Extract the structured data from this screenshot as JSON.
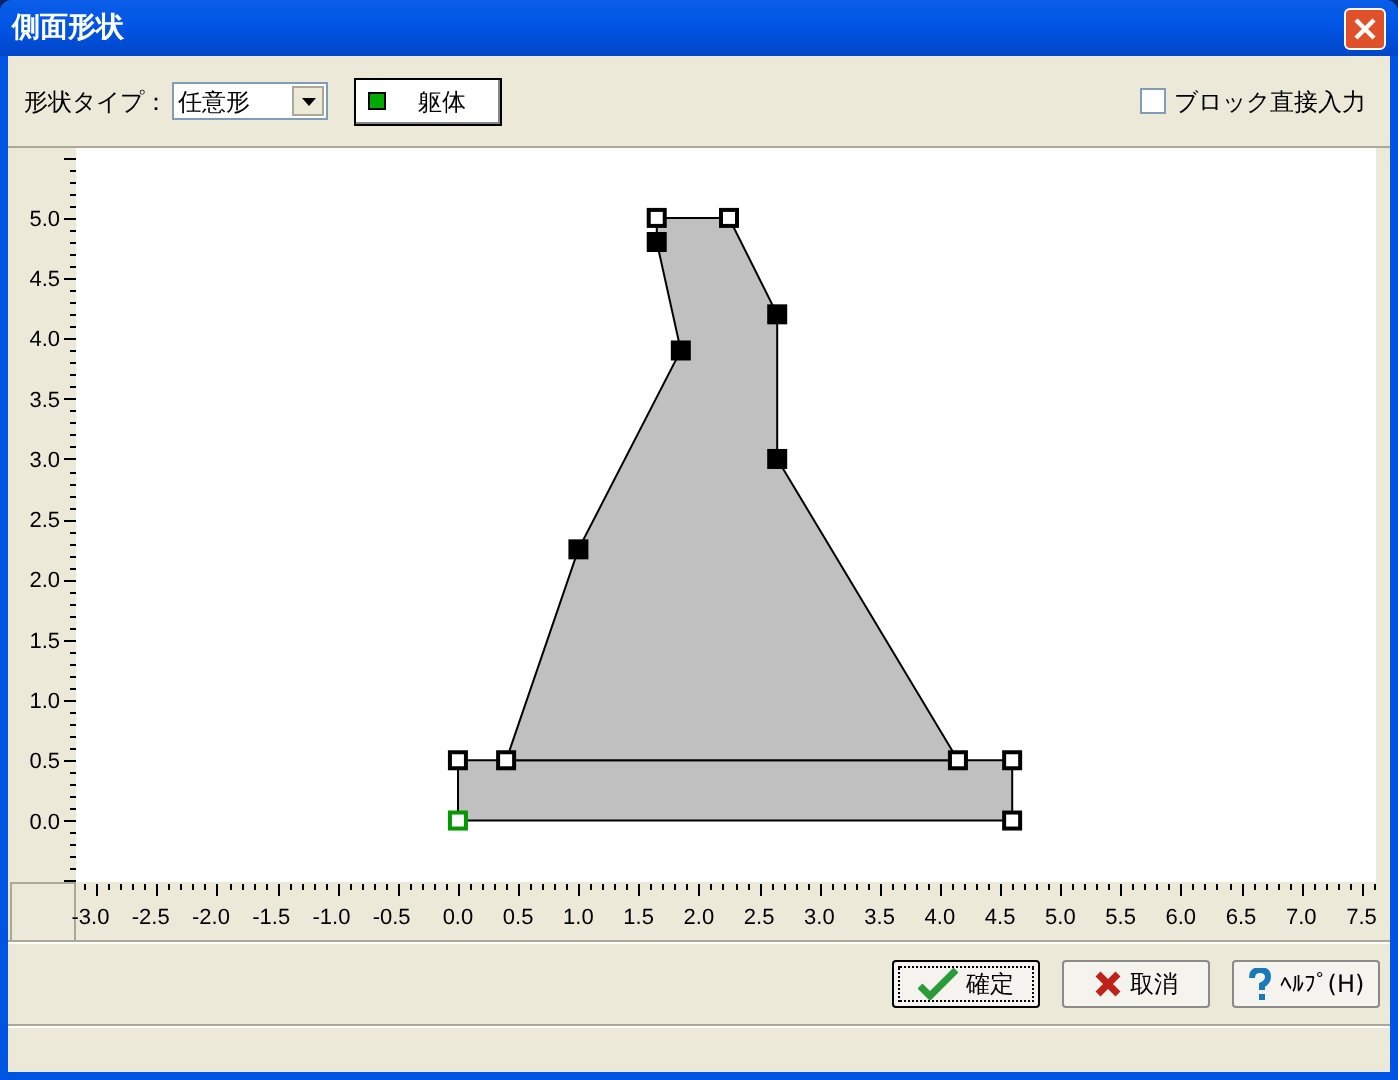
{
  "window": {
    "title": "側面形状"
  },
  "toolbar": {
    "shape_type_label": "形状タイプ：",
    "shape_type": {
      "value": "任意形"
    },
    "legend": {
      "label": "躯体",
      "color": "#00aa00"
    },
    "block_direct_input": {
      "label": "ブロック直接入力",
      "checked": false
    }
  },
  "chart": {
    "chart_data": {
      "type": "area",
      "xlim": [
        -3.17,
        7.62
      ],
      "ylim": [
        -0.51,
        5.58
      ],
      "xticks": [
        {
          "value": -3,
          "label": "-3.0"
        },
        {
          "value": -2.5,
          "label": "-2.5"
        },
        {
          "value": -2,
          "label": "-2.0"
        },
        {
          "value": -1.5,
          "label": "-1.5"
        },
        {
          "value": -1,
          "label": "-1.0"
        },
        {
          "value": -0.5,
          "label": "-0.5"
        },
        {
          "value": 0,
          "label": "0.0"
        },
        {
          "value": 0.5,
          "label": "0.5"
        },
        {
          "value": 1,
          "label": "1.0"
        },
        {
          "value": 1.5,
          "label": "1.5"
        },
        {
          "value": 2,
          "label": "2.0"
        },
        {
          "value": 2.5,
          "label": "2.5"
        },
        {
          "value": 3,
          "label": "3.0"
        },
        {
          "value": 3.5,
          "label": "3.5"
        },
        {
          "value": 4,
          "label": "4.0"
        },
        {
          "value": 4.5,
          "label": "4.5"
        },
        {
          "value": 5,
          "label": "5.0"
        },
        {
          "value": 5.5,
          "label": "5.5"
        },
        {
          "value": 6,
          "label": "6.0"
        },
        {
          "value": 6.5,
          "label": "6.5"
        },
        {
          "value": 7,
          "label": "7.0"
        },
        {
          "value": 7.5,
          "label": "7.5"
        }
      ],
      "yticks": [
        {
          "value": 0,
          "label": "0.0"
        },
        {
          "value": 0.5,
          "label": "0.5"
        },
        {
          "value": 1,
          "label": "1.0"
        },
        {
          "value": 1.5,
          "label": "1.5"
        },
        {
          "value": 2,
          "label": "2.0"
        },
        {
          "value": 2.5,
          "label": "2.5"
        },
        {
          "value": 3,
          "label": "3.0"
        },
        {
          "value": 3.5,
          "label": "3.5"
        },
        {
          "value": 4,
          "label": "4.0"
        },
        {
          "value": 4.5,
          "label": "4.5"
        },
        {
          "value": 5,
          "label": "5.0"
        }
      ],
      "series": [
        {
          "color": "#000000",
          "x": [
            0,
            4.6,
            4.6,
            0,
            0
          ],
          "values": [
            0,
            0,
            0.5,
            0.5,
            0
          ]
        },
        {
          "color": "#000000",
          "x": [
            0.4,
            4.15,
            2.65,
            2.65,
            2.25,
            1.65,
            1.65,
            1.85,
            1.0,
            0.4
          ],
          "values": [
            0.5,
            0.5,
            3.0,
            4.2,
            5.0,
            5.0,
            4.8,
            3.9,
            2.25,
            0.5
          ]
        },
        {
          "type": "scatter",
          "marker": "square-open",
          "color": "#009900",
          "x": [
            0
          ],
          "values": [
            0
          ]
        },
        {
          "type": "scatter",
          "marker": "square-open",
          "color": "#000000",
          "x": [
            0,
            0.4,
            4.15,
            4.6,
            4.6,
            1.65,
            2.25
          ],
          "values": [
            0.5,
            0.5,
            0.5,
            0.5,
            0,
            5.0,
            5.0
          ]
        },
        {
          "type": "scatter",
          "marker": "square",
          "color": "#000000",
          "x": [
            1.65,
            1.85,
            2.65,
            2.65,
            1.0
          ],
          "values": [
            4.8,
            3.9,
            4.2,
            3.0,
            2.25
          ]
        }
      ]
    }
  },
  "buttons": [
    {
      "label": "確定",
      "kind": "ok",
      "focused": true
    },
    {
      "label": "取消",
      "kind": "cancel",
      "focused": false
    },
    {
      "label": "ﾍﾙﾌﾟ(H)",
      "kind": "help",
      "focused": false
    }
  ]
}
